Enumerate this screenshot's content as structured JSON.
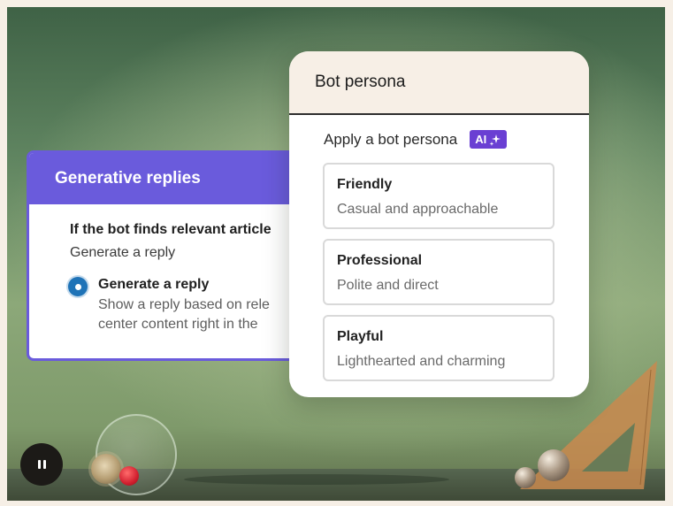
{
  "generative_card": {
    "title": "Generative replies",
    "question": "If the bot finds relevant article",
    "selected_value": "Generate a reply",
    "option": {
      "title": "Generate a reply",
      "description_line1": "Show a reply based on rele",
      "description_line2": "center content right in the"
    }
  },
  "persona_card": {
    "title": "Bot persona",
    "subtitle": "Apply a bot persona",
    "ai_badge": "AI",
    "options": [
      {
        "title": "Friendly",
        "description": "Casual and approachable"
      },
      {
        "title": "Professional",
        "description": "Polite and direct"
      },
      {
        "title": "Playful",
        "description": "Lighthearted and charming"
      }
    ]
  },
  "controls": {
    "pause_icon": "pause-icon"
  },
  "colors": {
    "accent_purple": "#6a5bdc",
    "ai_badge": "#6a3fd3",
    "radio_blue": "#1f73b7",
    "persona_header_bg": "#f7efe6"
  }
}
